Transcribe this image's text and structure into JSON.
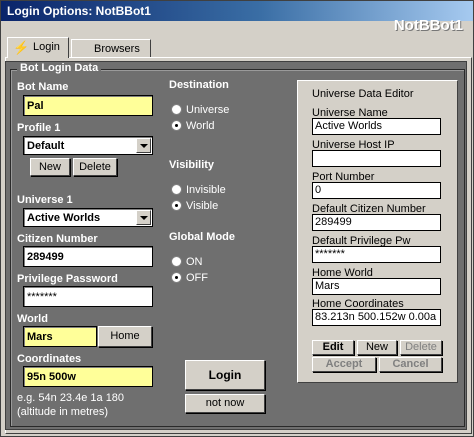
{
  "window": {
    "title": "Login Options: NotBBot1",
    "brand": "NotBBot1"
  },
  "tabs": [
    {
      "label": "Login"
    },
    {
      "label": "Browsers"
    }
  ],
  "group": {
    "title": "Bot Login Data"
  },
  "form": {
    "bot_name_label": "Bot Name",
    "bot_name": "Pal",
    "profile_label": "Profile 1",
    "profile_value": "Default",
    "new_label": "New",
    "delete_label": "Delete",
    "universe_label": "Universe 1",
    "universe_value": "Active Worlds",
    "citizen_label": "Citizen Number",
    "citizen_value": "289499",
    "privilege_label": "Privilege Password",
    "privilege_value": "*******",
    "world_label": "World",
    "world_value": "Mars",
    "home_label": "Home",
    "coords_label": "Coordinates",
    "coords_value": "95n 500w",
    "hint_line1": "e.g. 54n 23.4e 1a 180",
    "hint_line2": "(altitude in metres)"
  },
  "destination": {
    "label": "Destination",
    "options": [
      "Universe",
      "World"
    ],
    "selected": "World"
  },
  "visibility": {
    "label": "Visibility",
    "options": [
      "Invisible",
      "Visible"
    ],
    "selected": "Visible"
  },
  "global_mode": {
    "label": "Global Mode",
    "options": [
      "ON",
      "OFF"
    ],
    "selected": "OFF"
  },
  "actions": {
    "login": "Login",
    "not_now": "not now"
  },
  "editor": {
    "title": "Universe Data Editor",
    "universe_name_label": "Universe Name",
    "universe_name": "Active Worlds",
    "host_ip_label": "Universe Host IP",
    "host_ip": "",
    "port_label": "Port Number",
    "port": "0",
    "default_citizen_label": "Default Citizen Number",
    "default_citizen": "289499",
    "default_priv_label": "Default Privilege Pw",
    "default_priv": "*******",
    "home_world_label": "Home World",
    "home_world": "Mars",
    "home_coords_label": "Home Coordinates",
    "home_coords": "83.213n 500.152w 0.00a 1",
    "edit": "Edit",
    "new": "New",
    "delete": "Delete",
    "accept": "Accept",
    "cancel": "Cancel"
  },
  "colors": {
    "panel": "#6f6f6f",
    "highlight": "#ffff99",
    "titlebar": "#0a246a"
  }
}
